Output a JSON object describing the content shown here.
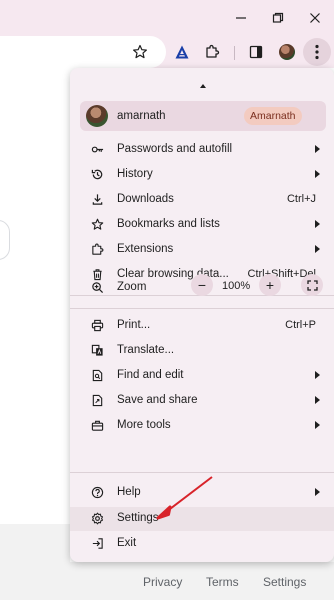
{
  "window": {
    "minimize_icon": "minimize-icon",
    "restore_icon": "restore-icon",
    "close_icon": "close-icon"
  },
  "toolbar": {
    "icons": [
      "star-icon",
      "extension-a-icon",
      "puzzle-icon",
      "side-panel-icon",
      "avatar",
      "kebab-menu-icon"
    ]
  },
  "menu": {
    "profile": {
      "name": "amarnath",
      "chip": "Amarnath"
    },
    "items_group1": [
      {
        "label": "Passwords and autofill",
        "shortcut": "",
        "submenu": true,
        "icon": "key-icon"
      },
      {
        "label": "History",
        "shortcut": "",
        "submenu": true,
        "icon": "history-icon"
      },
      {
        "label": "Downloads",
        "shortcut": "Ctrl+J",
        "submenu": false,
        "icon": "download-icon"
      },
      {
        "label": "Bookmarks and lists",
        "shortcut": "",
        "submenu": true,
        "icon": "star-outline-icon"
      },
      {
        "label": "Extensions",
        "shortcut": "",
        "submenu": true,
        "icon": "puzzle-icon"
      },
      {
        "label": "Clear browsing data...",
        "shortcut": "Ctrl+Shift+Del",
        "submenu": false,
        "icon": "trash-icon"
      }
    ],
    "zoom": {
      "label": "Zoom",
      "value": "100%",
      "minus": "−",
      "plus": "+"
    },
    "items_group2": [
      {
        "label": "Print...",
        "shortcut": "Ctrl+P",
        "submenu": false,
        "icon": "print-icon"
      },
      {
        "label": "Translate...",
        "shortcut": "",
        "submenu": false,
        "icon": "translate-icon"
      },
      {
        "label": "Find and edit",
        "shortcut": "",
        "submenu": true,
        "icon": "find-icon"
      },
      {
        "label": "Save and share",
        "shortcut": "",
        "submenu": true,
        "icon": "save-share-icon"
      },
      {
        "label": "More tools",
        "shortcut": "",
        "submenu": true,
        "icon": "toolbox-icon"
      }
    ],
    "items_group3": [
      {
        "label": "Help",
        "shortcut": "",
        "submenu": true,
        "icon": "help-icon"
      },
      {
        "label": "Settings",
        "shortcut": "",
        "submenu": false,
        "icon": "gear-icon"
      },
      {
        "label": "Exit",
        "shortcut": "",
        "submenu": false,
        "icon": "exit-icon"
      }
    ]
  },
  "footer": {
    "privacy": "Privacy",
    "terms": "Terms",
    "settings": "Settings"
  },
  "colors": {
    "titlebar": "#f6e8f0",
    "menu_bg": "#f6eef3",
    "profile_chip": "#f3cbc0",
    "annotation_arrow": "#d8232a"
  }
}
